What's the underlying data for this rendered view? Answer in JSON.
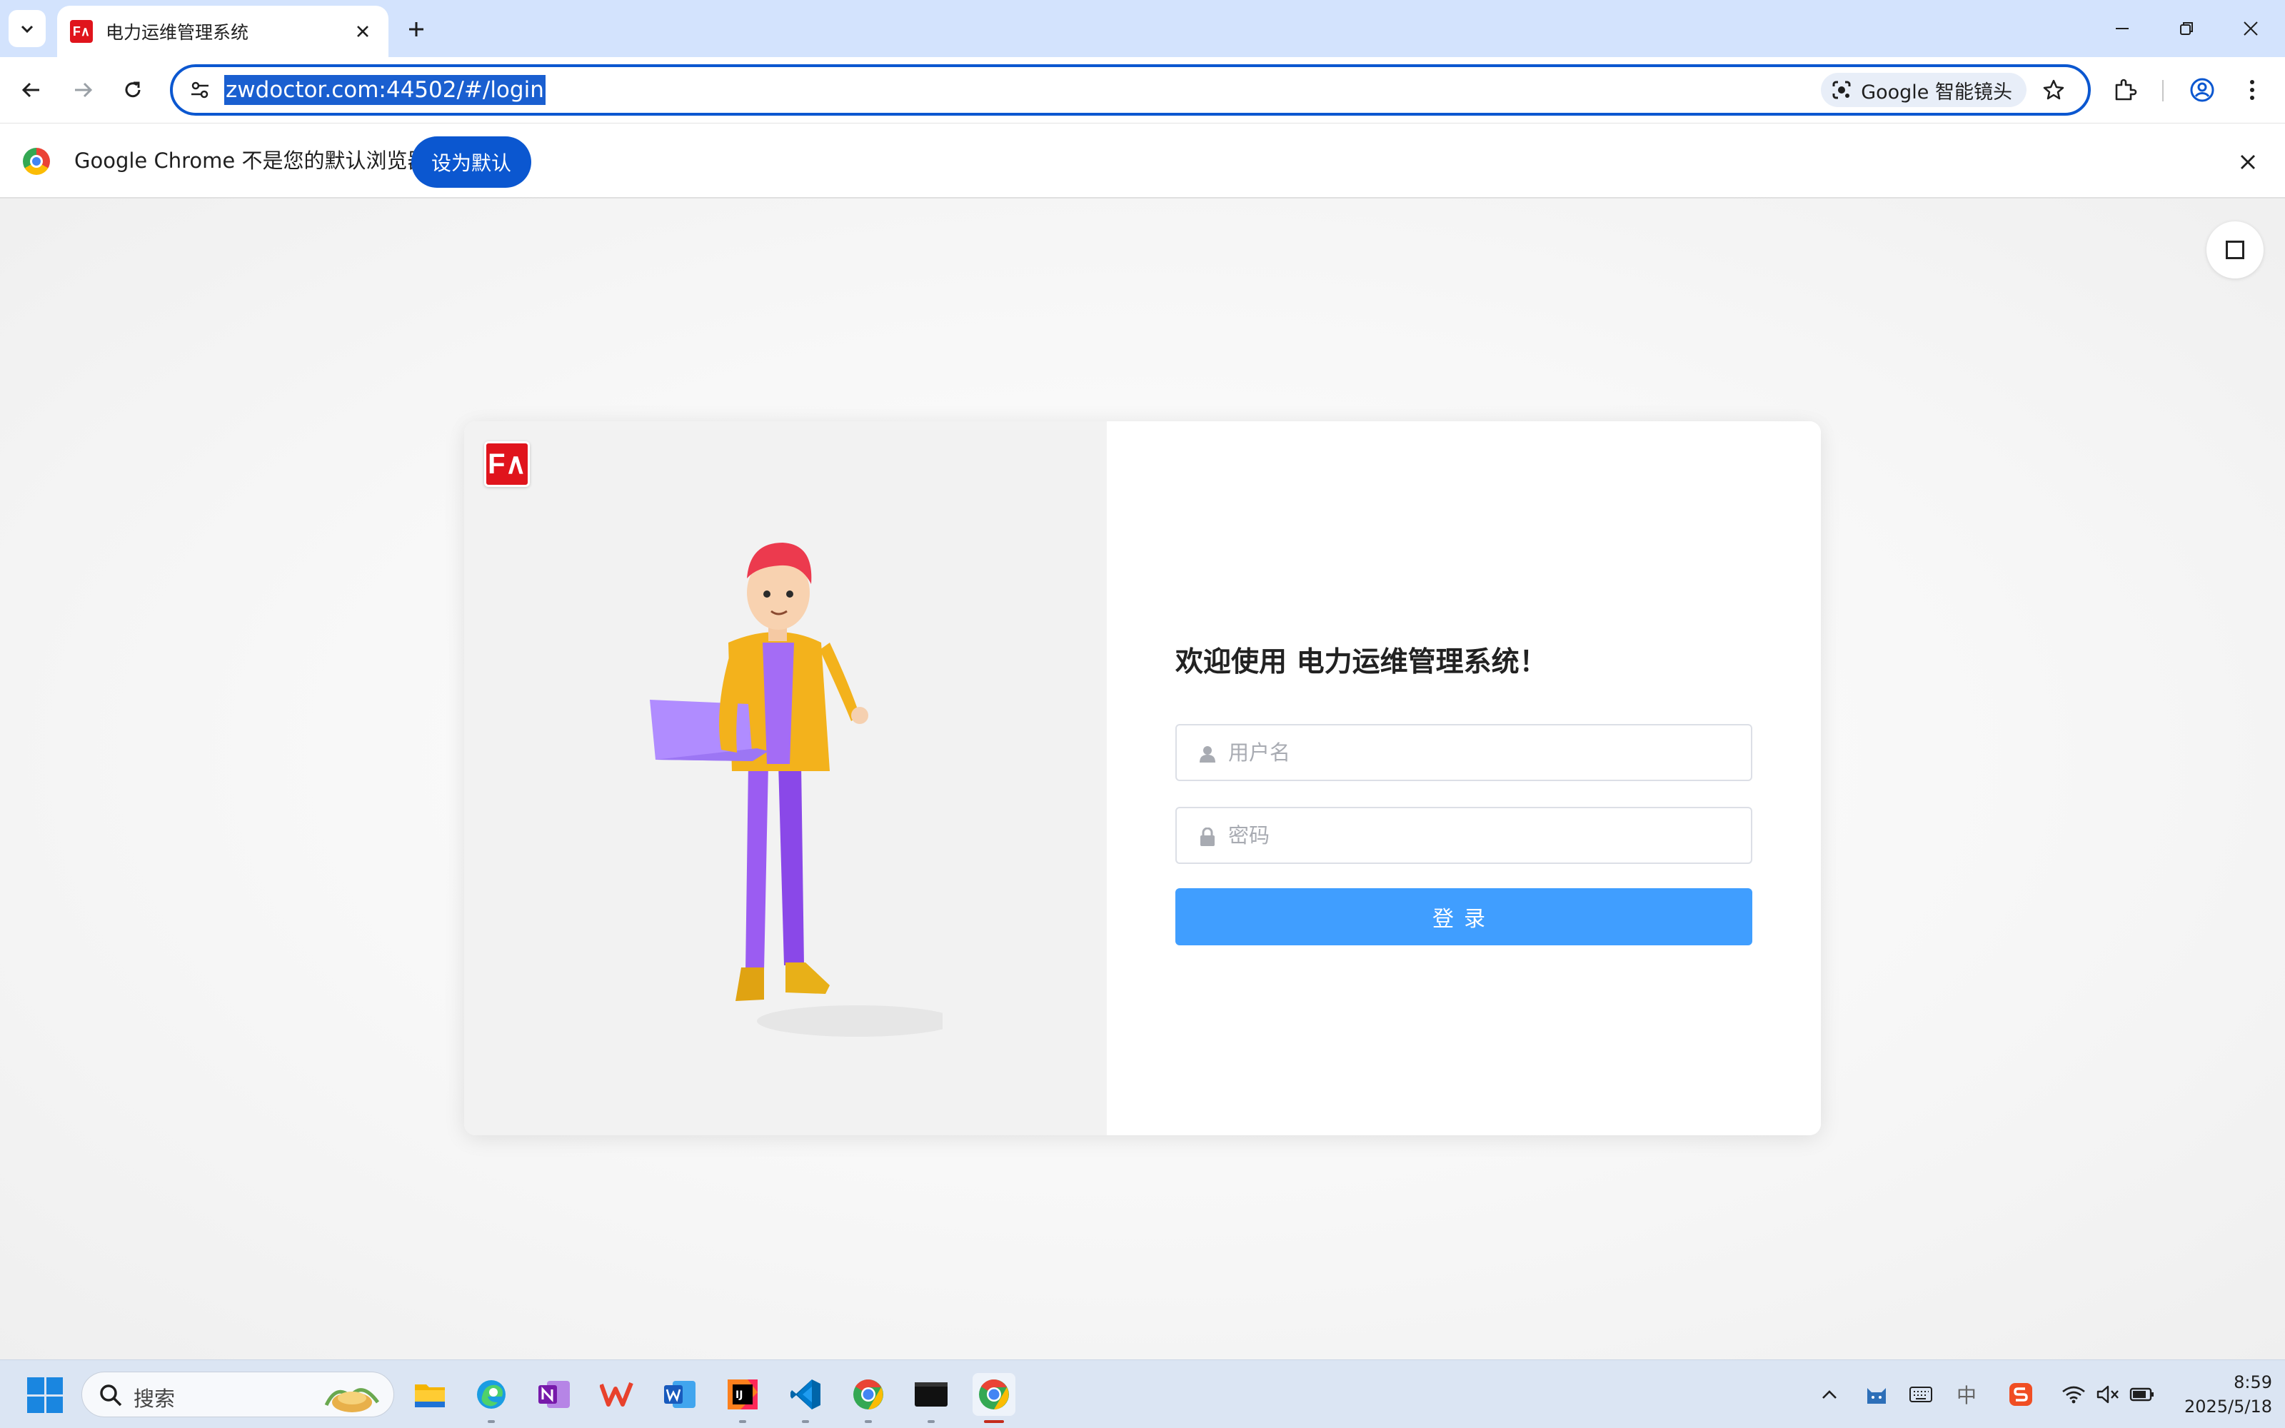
{
  "browser": {
    "tab": {
      "favicon_text": "F∧",
      "title": "电力运维管理系统"
    },
    "url": "zwdoctor.com:44502/#/login",
    "lens_label": "Google 智能镜头"
  },
  "infobar": {
    "message": "Google Chrome 不是您的默认浏览器",
    "set_default_label": "设为默认"
  },
  "login": {
    "logo_text": "F∧",
    "welcome": "欢迎使用 电力运维管理系统！",
    "username_placeholder": "用户名",
    "password_placeholder": "密码",
    "submit_label": "登录"
  },
  "taskbar": {
    "search_placeholder": "搜索",
    "apps": [
      "file-explorer",
      "edge",
      "onenote",
      "wps",
      "word",
      "intellij",
      "vscode",
      "chrome",
      "terminal",
      "chrome-active"
    ],
    "tray_ime": "中",
    "time": "8:59",
    "date": "2025/5/18"
  },
  "colors": {
    "accent": "#0b57d0",
    "login_button": "#409eff",
    "brand_red": "#e0141c"
  }
}
